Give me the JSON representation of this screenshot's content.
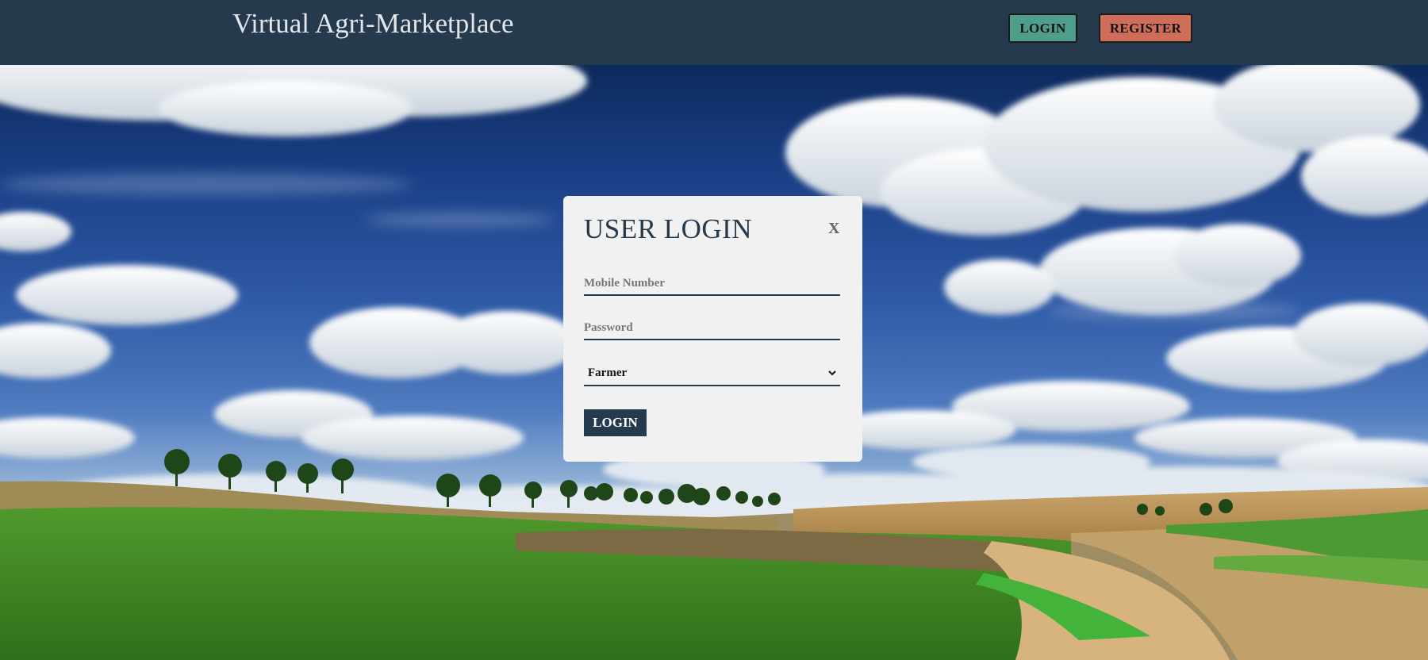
{
  "header": {
    "title": "Virtual Agri-Marketplace",
    "login_label": "LOGIN",
    "register_label": "REGISTER",
    "colors": {
      "background": "#253a4d",
      "login_button": "#4f9e8c",
      "register_button": "#cf6e58"
    }
  },
  "background": {
    "icon": "landscape-sky-fields-image"
  },
  "login_modal": {
    "title": "USER LOGIN",
    "close_label": "X",
    "mobile": {
      "placeholder": "Mobile Number",
      "value": ""
    },
    "password": {
      "placeholder": "Password",
      "value": ""
    },
    "role_select": {
      "selected": "Farmer",
      "icon": "chevron-down-icon"
    },
    "submit_label": "LOGIN",
    "colors": {
      "accent": "#253a4d",
      "background": "#f1f1f1"
    }
  }
}
